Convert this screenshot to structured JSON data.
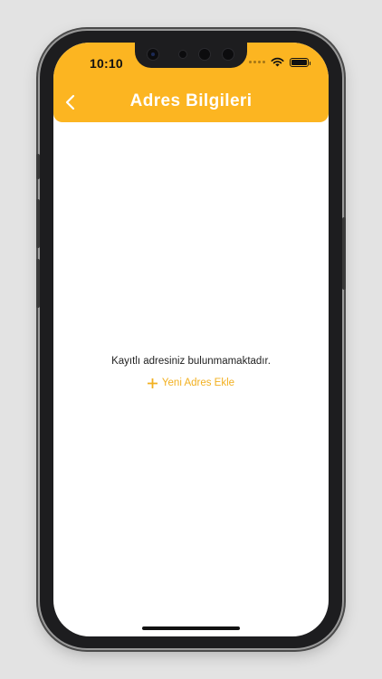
{
  "status_bar": {
    "time": "10:10",
    "signal_icon": "cellular-dots-icon",
    "wifi_icon": "wifi-icon",
    "battery_icon": "battery-icon"
  },
  "header": {
    "title": "Adres Bilgileri",
    "back_icon": "chevron-left-icon"
  },
  "main": {
    "empty_message": "Kayıtlı adresiniz bulunmamaktadır.",
    "add_button": {
      "label": "Yeni Adres Ekle",
      "icon": "plus-icon"
    }
  },
  "colors": {
    "accent": "#fcb521",
    "accent_text": "#f2b020",
    "header_text": "#ffffff",
    "body_text": "#222222"
  }
}
